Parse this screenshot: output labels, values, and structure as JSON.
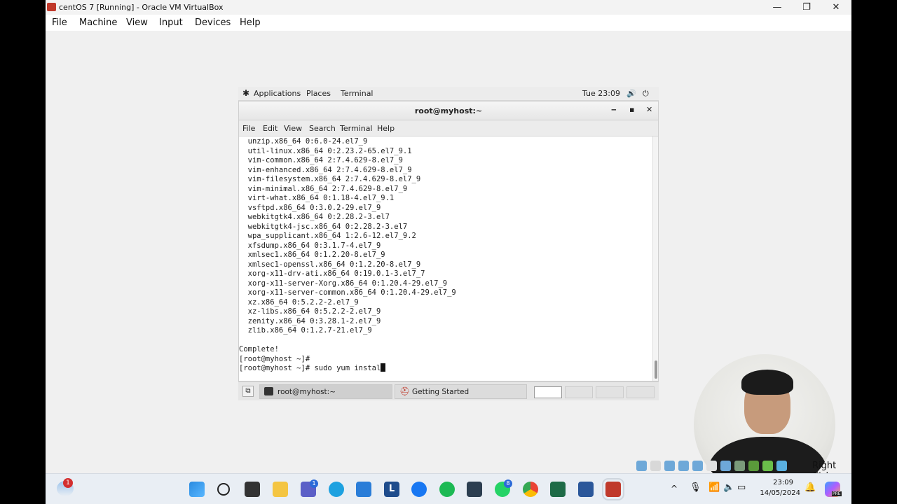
{
  "host_window": {
    "title": "centOS 7 [Running] - Oracle VM VirtualBox",
    "controls": {
      "minimize": "—",
      "maximize": "❐",
      "close": "✕"
    }
  },
  "host_menu": [
    "File",
    "Machine",
    "View",
    "Input",
    "Devices",
    "Help"
  ],
  "guest_topbar": {
    "applications": "Applications",
    "places": "Places",
    "terminal": "Terminal",
    "clock": "Tue 23:09"
  },
  "terminal_window": {
    "title": "root@myhost:~",
    "controls": {
      "minimize": "‒",
      "maximize": "▪",
      "close": "✕"
    },
    "menu": [
      "File",
      "Edit",
      "View",
      "Search",
      "Terminal",
      "Help"
    ],
    "lines": [
      "  unzip.x86_64 0:6.0-24.el7_9",
      "  util-linux.x86_64 0:2.23.2-65.el7_9.1",
      "  vim-common.x86_64 2:7.4.629-8.el7_9",
      "  vim-enhanced.x86_64 2:7.4.629-8.el7_9",
      "  vim-filesystem.x86_64 2:7.4.629-8.el7_9",
      "  vim-minimal.x86_64 2:7.4.629-8.el7_9",
      "  virt-what.x86_64 0:1.18-4.el7_9.1",
      "  vsftpd.x86_64 0:3.0.2-29.el7_9",
      "  webkitgtk4.x86_64 0:2.28.2-3.el7",
      "  webkitgtk4-jsc.x86_64 0:2.28.2-3.el7",
      "  wpa_supplicant.x86_64 1:2.6-12.el7_9.2",
      "  xfsdump.x86_64 0:3.1.7-4.el7_9",
      "  xmlsec1.x86_64 0:1.2.20-8.el7_9",
      "  xmlsec1-openssl.x86_64 0:1.2.20-8.el7_9",
      "  xorg-x11-drv-ati.x86_64 0:19.0.1-3.el7_7",
      "  xorg-x11-server-Xorg.x86_64 0:1.20.4-29.el7_9",
      "  xorg-x11-server-common.x86_64 0:1.20.4-29.el7_9",
      "  xz.x86_64 0:5.2.2-2.el7_9",
      "  xz-libs.x86_64 0:5.2.2-2.el7_9",
      "  zenity.x86_64 0:3.28.1-2.el7_9",
      "  zlib.x86_64 0:1.2.7-21.el7_9",
      "",
      "Complete!",
      "[root@myhost ~]#"
    ],
    "prompt": "[root@myhost ~]# ",
    "current_input": "sudo yum instal"
  },
  "guest_taskbar": {
    "task1": "root@myhost:~",
    "task2": "Getting Started"
  },
  "vm_status": {
    "host_key": "Right Ctrl"
  },
  "host_taskbar": {
    "weather_badge": "1",
    "teams_badge": "1",
    "whatsapp_badge": "8",
    "time": "23:09",
    "date": "14/05/2024",
    "copilot_badge": "PRE"
  }
}
